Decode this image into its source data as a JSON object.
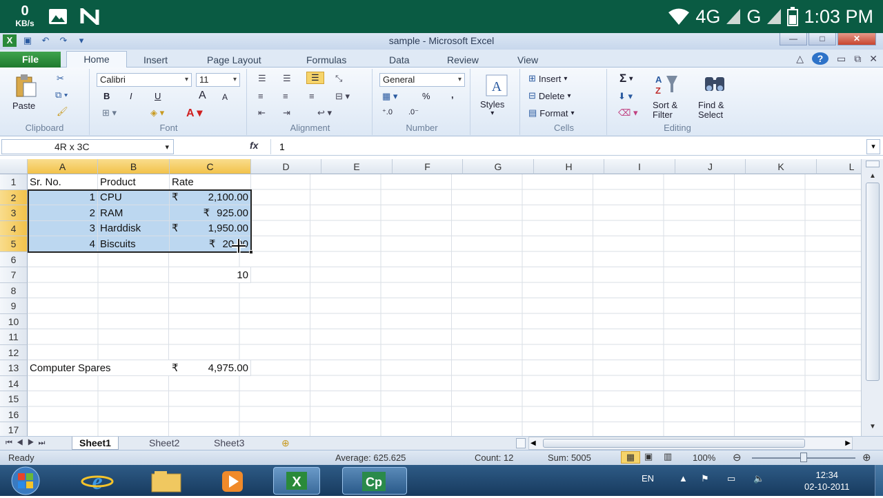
{
  "phone_status": {
    "kb_value": "0",
    "kb_unit": "KB/s",
    "network1": "4G",
    "network2": "G",
    "time": "1:03 PM"
  },
  "window": {
    "title": "sample - Microsoft Excel"
  },
  "tabs": [
    "File",
    "Home",
    "Insert",
    "Page Layout",
    "Formulas",
    "Data",
    "Review",
    "View"
  ],
  "ribbon": {
    "clipboard": {
      "paste": "Paste",
      "label": "Clipboard"
    },
    "font": {
      "name": "Calibri",
      "size": "11",
      "bold": "B",
      "italic": "I",
      "underline": "U",
      "grow": "A",
      "shrink": "A",
      "label": "Font"
    },
    "alignment": {
      "label": "Alignment"
    },
    "number": {
      "format": "General",
      "percent": "%",
      "comma": ",",
      "label": "Number"
    },
    "styles": {
      "label": "Styles"
    },
    "cells": {
      "insert": "Insert",
      "delete": "Delete",
      "format": "Format",
      "label": "Cells"
    },
    "editing": {
      "sigma": "Σ",
      "sort1": "Sort &",
      "sort2": "Filter",
      "find1": "Find &",
      "find2": "Select",
      "label": "Editing"
    }
  },
  "formula_bar": {
    "name_box": "4R x 3C",
    "fx": "fx",
    "value": "1"
  },
  "columns": [
    "A",
    "B",
    "C",
    "D",
    "E",
    "F",
    "G",
    "H",
    "I",
    "J",
    "K",
    "L"
  ],
  "rows": [
    "1",
    "2",
    "3",
    "4",
    "5",
    "6",
    "7",
    "8",
    "9",
    "10",
    "11",
    "12",
    "13",
    "14",
    "15",
    "16",
    "17"
  ],
  "cells": {
    "a1": "Sr. No.",
    "b1": "Product",
    "c1": "Rate",
    "a2": "1",
    "b2": "CPU",
    "c2_cur": "₹",
    "c2": "2,100.00",
    "a3": "2",
    "b3": "RAM",
    "c3_cur": "₹",
    "c3": "925.00",
    "a4": "3",
    "b4": "Harddisk",
    "c4_cur": "₹",
    "c4": "1,950.00",
    "a5": "4",
    "b5": "Biscuits",
    "c5_cur": "₹",
    "c5": "20.00",
    "c7": "10",
    "a13": "Computer Spares",
    "c13_cur": "₹",
    "c13": "4,975.00"
  },
  "sheets": [
    "Sheet1",
    "Sheet2",
    "Sheet3"
  ],
  "status": {
    "ready": "Ready",
    "average": "Average: 625.625",
    "count": "Count: 12",
    "sum": "Sum: 5005",
    "zoom": "100%"
  },
  "taskbar": {
    "lang": "EN",
    "clock_time": "12:34",
    "clock_date": "02-10-2011"
  }
}
